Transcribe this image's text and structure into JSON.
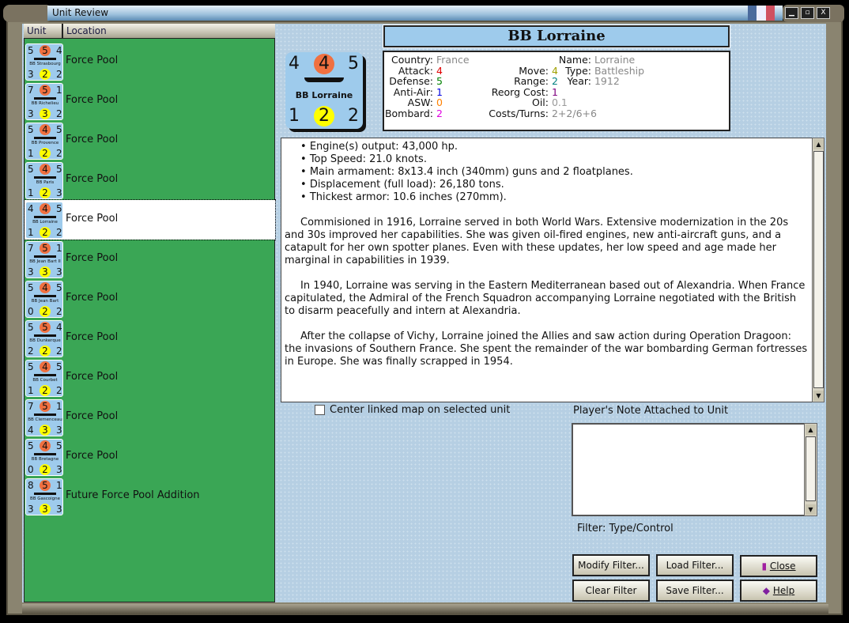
{
  "window": {
    "title": "Unit Review"
  },
  "list": {
    "headers": [
      "Unit",
      "Location"
    ],
    "rows": [
      {
        "name": "BB Strasbourg",
        "top": [
          "5",
          "5",
          "4"
        ],
        "bottom": [
          "3",
          "2",
          "2"
        ],
        "location": "Force Pool"
      },
      {
        "name": "BB Richelieu",
        "top": [
          "7",
          "5",
          "1"
        ],
        "bottom": [
          "3",
          "3",
          "2"
        ],
        "location": "Force Pool"
      },
      {
        "name": "BB Provence",
        "top": [
          "5",
          "4",
          "5"
        ],
        "bottom": [
          "1",
          "2",
          "2"
        ],
        "location": "Force Pool"
      },
      {
        "name": "BB Paris",
        "top": [
          "5",
          "4",
          "5"
        ],
        "bottom": [
          "1",
          "2",
          "3"
        ],
        "location": "Force Pool"
      },
      {
        "name": "BB Lorraine",
        "top": [
          "4",
          "4",
          "5"
        ],
        "bottom": [
          "1",
          "2",
          "2"
        ],
        "location": "Force Pool",
        "selected": true
      },
      {
        "name": "BB Jean Bart II",
        "top": [
          "7",
          "5",
          "1"
        ],
        "bottom": [
          "3",
          "3",
          "3"
        ],
        "location": "Force Pool"
      },
      {
        "name": "BB Jean Bart",
        "top": [
          "5",
          "4",
          "5"
        ],
        "bottom": [
          "0",
          "2",
          "2"
        ],
        "location": "Force Pool"
      },
      {
        "name": "BB Dunkerque",
        "top": [
          "5",
          "5",
          "4"
        ],
        "bottom": [
          "2",
          "2",
          "2"
        ],
        "location": "Force Pool"
      },
      {
        "name": "BB Courbet",
        "top": [
          "5",
          "4",
          "5"
        ],
        "bottom": [
          "1",
          "2",
          "2"
        ],
        "location": "Force Pool"
      },
      {
        "name": "BB Clemenceau",
        "top": [
          "7",
          "5",
          "1"
        ],
        "bottom": [
          "4",
          "3",
          "3"
        ],
        "location": "Force Pool"
      },
      {
        "name": "BB Bretagne",
        "top": [
          "5",
          "4",
          "5"
        ],
        "bottom": [
          "0",
          "2",
          "3"
        ],
        "location": "Force Pool"
      },
      {
        "name": "BB Gascoigne",
        "top": [
          "8",
          "5",
          "1"
        ],
        "bottom": [
          "3",
          "3",
          "3"
        ],
        "location": "Future Force Pool Addition"
      }
    ]
  },
  "unit": {
    "title": "BB Lorraine",
    "counter": {
      "name": "BB Lorraine",
      "top": [
        "4",
        "4",
        "5"
      ],
      "bottom": [
        "1",
        "2",
        "2"
      ]
    },
    "col1": [
      [
        "Country:",
        "France",
        "#888888"
      ],
      [
        "Attack:",
        "4",
        "#e00000"
      ],
      [
        "Defense:",
        "5",
        "#008000"
      ],
      [
        "Anti-Air:",
        "1",
        "#0000e0"
      ],
      [
        "ASW:",
        "0",
        "#ff8000"
      ],
      [
        "Bombard:",
        "2",
        "#e000e0"
      ]
    ],
    "col2": [
      [
        "Move:",
        "4",
        "#a0a000"
      ],
      [
        "Range:",
        "2",
        "#008080"
      ],
      [
        "Reorg Cost:",
        "1",
        "#800080"
      ],
      [
        "Oil:",
        "0.1",
        "#999999"
      ],
      [
        "Costs/Turns:",
        "2+2/6+6",
        "#888888"
      ]
    ],
    "col3": [
      [
        "Name:",
        "Lorraine",
        "#888888"
      ],
      [
        "Type:",
        "Battleship",
        "#888888"
      ],
      [
        "Year:",
        "1912",
        "#888888"
      ]
    ]
  },
  "description": {
    "bullets": [
      "Engine(s) output: 43,000 hp.",
      "Top Speed: 21.0 knots.",
      "Main armament: 8x13.4 inch (340mm) guns and 2 floatplanes.",
      "Displacement (full load): 26,180 tons.",
      "Thickest armor: 10.6 inches (270mm)."
    ],
    "paragraphs": [
      "Commisioned in 1916, Lorraine served in both World Wars. Extensive modernization in the 20s and 30s improved her capabilities. She was given oil-fired engines, new anti-aircraft guns, and a catapult for her own spotter planes. Even with these updates, her low speed and age made her marginal in capabilities in 1939.",
      "In 1940, Lorraine was serving in the Eastern Mediterranean based out of Alexandria.  When France capitulated, the Admiral of the French Squadron accompanying Lorraine negotiated with the British to disarm peacefully and intern at Alexandria.",
      "After the collapse of Vichy, Lorraine joined the Allies and saw action during Operation Dragoon: the invasions of Southern France.  She spent the remainder of the war bombarding German fortresses in Europe.  She was finally scrapped in 1954."
    ]
  },
  "controls": {
    "center_map": "Center linked map on selected unit",
    "note_label": "Player's Note Attached to Unit",
    "filter": "Filter:  Type/Control"
  },
  "buttons": {
    "modify": "Modify Filter...",
    "load": "Load Filter...",
    "close": "Close",
    "clear": "Clear Filter",
    "save": "Save Filter...",
    "help": "Help"
  }
}
